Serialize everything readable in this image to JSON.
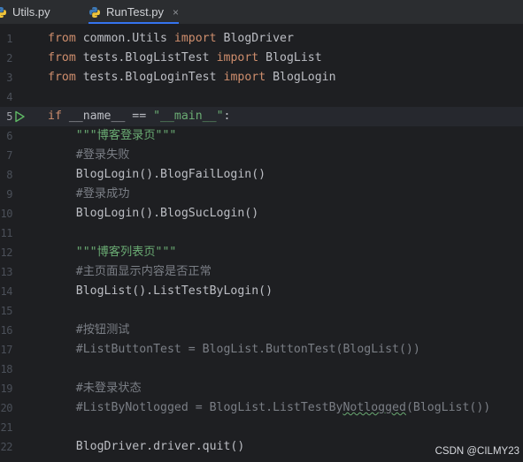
{
  "tabs": [
    {
      "label": "Utils.py",
      "active": false
    },
    {
      "label": "RunTest.py",
      "active": true,
      "close_glyph": "×"
    }
  ],
  "editor": {
    "lines": [
      {
        "n": "1",
        "segments": [
          {
            "t": "from",
            "c": "kw"
          },
          {
            "t": " common.Utils ",
            "c": ""
          },
          {
            "t": "import",
            "c": "kw"
          },
          {
            "t": " BlogDriver",
            "c": ""
          }
        ]
      },
      {
        "n": "2",
        "segments": [
          {
            "t": "from",
            "c": "kw"
          },
          {
            "t": " tests.BlogListTest ",
            "c": ""
          },
          {
            "t": "import",
            "c": "kw"
          },
          {
            "t": " BlogList",
            "c": ""
          }
        ]
      },
      {
        "n": "3",
        "segments": [
          {
            "t": "from",
            "c": "kw"
          },
          {
            "t": " tests.BlogLoginTest ",
            "c": ""
          },
          {
            "t": "import",
            "c": "kw"
          },
          {
            "t": " BlogLogin",
            "c": ""
          }
        ]
      },
      {
        "n": "4",
        "segments": []
      },
      {
        "n": "5",
        "current": true,
        "run": true,
        "segments": [
          {
            "t": "if",
            "c": "kw"
          },
          {
            "t": " __name__ == ",
            "c": ""
          },
          {
            "t": "\"__main__\"",
            "c": "str"
          },
          {
            "t": ":",
            "c": ""
          }
        ]
      },
      {
        "n": "6",
        "segments": [
          {
            "t": "    ",
            "c": ""
          },
          {
            "t": "\"\"\"博客登录页\"\"\"",
            "c": "str"
          }
        ]
      },
      {
        "n": "7",
        "segments": [
          {
            "t": "    #登录失败",
            "c": "cmt"
          }
        ]
      },
      {
        "n": "8",
        "segments": [
          {
            "t": "    BlogLogin().BlogFailLogin()",
            "c": ""
          }
        ]
      },
      {
        "n": "9",
        "segments": [
          {
            "t": "    #登录成功",
            "c": "cmt"
          }
        ]
      },
      {
        "n": "10",
        "segments": [
          {
            "t": "    BlogLogin().BlogSucLogin()",
            "c": ""
          }
        ]
      },
      {
        "n": "11",
        "segments": []
      },
      {
        "n": "12",
        "segments": [
          {
            "t": "    ",
            "c": ""
          },
          {
            "t": "\"\"\"博客列表页\"\"\"",
            "c": "str"
          }
        ]
      },
      {
        "n": "13",
        "segments": [
          {
            "t": "    #主页面显示内容是否正常",
            "c": "cmt"
          }
        ]
      },
      {
        "n": "14",
        "segments": [
          {
            "t": "    BlogList().ListTestByLogin()",
            "c": ""
          }
        ]
      },
      {
        "n": "15",
        "segments": []
      },
      {
        "n": "16",
        "segments": [
          {
            "t": "    #按钮测试",
            "c": "cmt"
          }
        ]
      },
      {
        "n": "17",
        "segments": [
          {
            "t": "    #ListButtonTest = BlogList.ButtonTest(BlogList())",
            "c": "cmt"
          }
        ]
      },
      {
        "n": "18",
        "segments": []
      },
      {
        "n": "19",
        "segments": [
          {
            "t": "    #未登录状态",
            "c": "cmt"
          }
        ]
      },
      {
        "n": "20",
        "segments": [
          {
            "t": "    #ListByNotlogged = BlogList.ListTestBy",
            "c": "cmt"
          },
          {
            "t": "Notlogged",
            "c": "cmt wavy"
          },
          {
            "t": "(BlogList())",
            "c": "cmt"
          }
        ]
      },
      {
        "n": "21",
        "segments": []
      },
      {
        "n": "22",
        "segments": [
          {
            "t": "    BlogDriver.driver.quit()",
            "c": ""
          }
        ]
      }
    ]
  },
  "watermark": "CSDN @CILMY23",
  "colors": {
    "background": "#1e1f22",
    "keyword": "#cf8e6d",
    "string": "#6aab73",
    "comment": "#7a7e85",
    "text": "#bcbec4",
    "accent": "#3574f0"
  }
}
